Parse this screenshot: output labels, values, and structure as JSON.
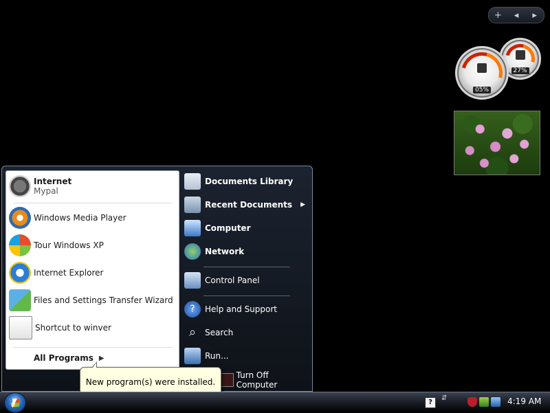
{
  "gadgets": {
    "toolbar": {
      "add_label": "+",
      "prev_label": "◂",
      "next_label": "▸"
    },
    "cpu_meter": {
      "value_label": "05%"
    },
    "memory_meter": {
      "value_label": "27%"
    },
    "slideshow": {
      "icon": "water-lilies-photo"
    }
  },
  "start_menu": {
    "pinned": [
      {
        "title": "Internet",
        "subtitle": "Mypal",
        "icon": "raccoon-browser-icon"
      },
      {
        "label": "Windows Media Player",
        "icon": "media-player-icon"
      },
      {
        "label": "Tour Windows XP",
        "icon": "windows-tour-icon"
      },
      {
        "label": "Internet Explorer",
        "icon": "internet-explorer-icon"
      },
      {
        "label": "Files and Settings Transfer Wizard",
        "icon": "transfer-wizard-icon"
      },
      {
        "label": "Shortcut to winver",
        "icon": "winver-shortcut-icon"
      }
    ],
    "all_programs_label": "All Programs",
    "right": {
      "documents_library": "Documents Library",
      "recent_documents": "Recent Documents",
      "computer": "Computer",
      "network": "Network",
      "control_panel": "Control Panel",
      "help_support": "Help and Support",
      "search": "Search",
      "run": "Run..."
    },
    "turn_off_label": "Turn Off Computer"
  },
  "balloon": {
    "text": "New program(s) were installed."
  },
  "taskbar": {
    "help_label": "?",
    "chevron": "⇵",
    "clock": "4:19 AM"
  }
}
